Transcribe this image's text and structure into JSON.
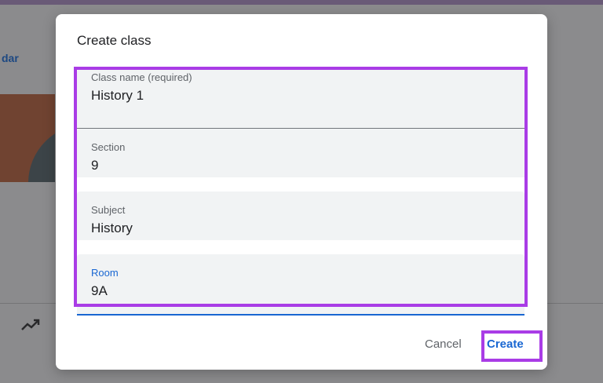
{
  "background": {
    "link_text": "dar",
    "icons": [
      "trending-up-icon"
    ]
  },
  "dialog": {
    "title": "Create class",
    "fields": [
      {
        "label": "Class name (required)",
        "value": "History 1"
      },
      {
        "label": "Section",
        "value": "9"
      },
      {
        "label": "Subject",
        "value": "History"
      },
      {
        "label": "Room",
        "value": "9A"
      }
    ],
    "cancel_label": "Cancel",
    "create_label": "Create"
  },
  "colors": {
    "highlight": "#a93ce6",
    "accent": "#1967d2",
    "field_bg": "#f1f3f4"
  }
}
